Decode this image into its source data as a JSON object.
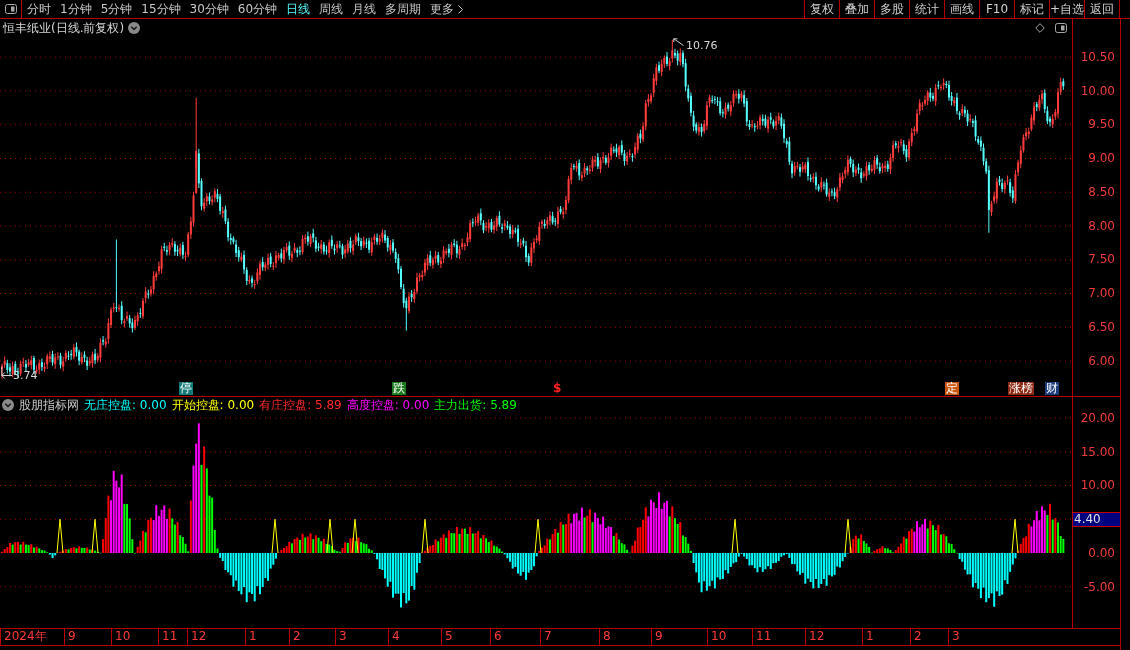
{
  "toolbar": {
    "periods": [
      {
        "label": "分时",
        "selected": false,
        "kind": "period"
      },
      {
        "label": "1分钟",
        "selected": false,
        "kind": "period"
      },
      {
        "label": "5分钟",
        "selected": false,
        "kind": "period"
      },
      {
        "label": "15分钟",
        "selected": false,
        "kind": "period"
      },
      {
        "label": "30分钟",
        "selected": false,
        "kind": "period"
      },
      {
        "label": "60分钟",
        "selected": false,
        "kind": "period"
      },
      {
        "label": "日线",
        "selected": true,
        "kind": "period"
      },
      {
        "label": "周线",
        "selected": false,
        "kind": "period"
      },
      {
        "label": "月线",
        "selected": false,
        "kind": "period"
      },
      {
        "label": "多周期",
        "selected": false,
        "kind": "period"
      },
      {
        "label": "更多",
        "selected": false,
        "kind": "more"
      }
    ],
    "actions": [
      "复权",
      "叠加",
      "多股",
      "统计",
      "画线",
      "F10",
      "标记",
      "+自选",
      "返回"
    ]
  },
  "price_chart": {
    "title": "恒丰纸业(日线.前复权)",
    "high_label": "10.76",
    "low_label": "5.74",
    "markers": [
      {
        "text": "停",
        "kind": "badge",
        "color": "#137a78"
      },
      {
        "text": "跌",
        "kind": "badge",
        "color": "#1a7a1e"
      },
      {
        "text": "$",
        "kind": "sign",
        "color": "#ff2020"
      },
      {
        "text": "定",
        "kind": "badge",
        "color": "#c8560e"
      },
      {
        "text": "涨榜",
        "kind": "badge",
        "color": "#8c2a14"
      },
      {
        "text": "财",
        "kind": "badge",
        "color": "#1c3c7c"
      }
    ],
    "y_axis": [
      "10.50",
      "10.00",
      "9.50",
      "9.00",
      "8.50",
      "8.00",
      "7.50",
      "7.00",
      "6.50",
      "6.00"
    ]
  },
  "indicator": {
    "name": "股朋指标网",
    "values": [
      {
        "text": "无庄控盘: 0.00",
        "color": "#00ffff"
      },
      {
        "text": "开始控盘: 0.00",
        "color": "#ffff00"
      },
      {
        "text": "有庄控盘: 5.89",
        "color": "#ff2a2a"
      },
      {
        "text": "高度控盘: 0.00",
        "color": "#ff00ff"
      },
      {
        "text": "主力出货: 5.89",
        "color": "#00ff00"
      }
    ],
    "y_axis_upper": [
      "20.00",
      "15.00",
      "10.00"
    ],
    "current_value": "4.40",
    "y_axis_lower": [
      "0.00",
      "-5.00"
    ]
  },
  "time_axis": [
    "2024年",
    "9",
    "10",
    "11",
    "12",
    "1",
    "2",
    "3",
    "4",
    "5",
    "6",
    "7",
    "8",
    "9",
    "10",
    "11",
    "12",
    "1",
    "2",
    "3"
  ]
}
